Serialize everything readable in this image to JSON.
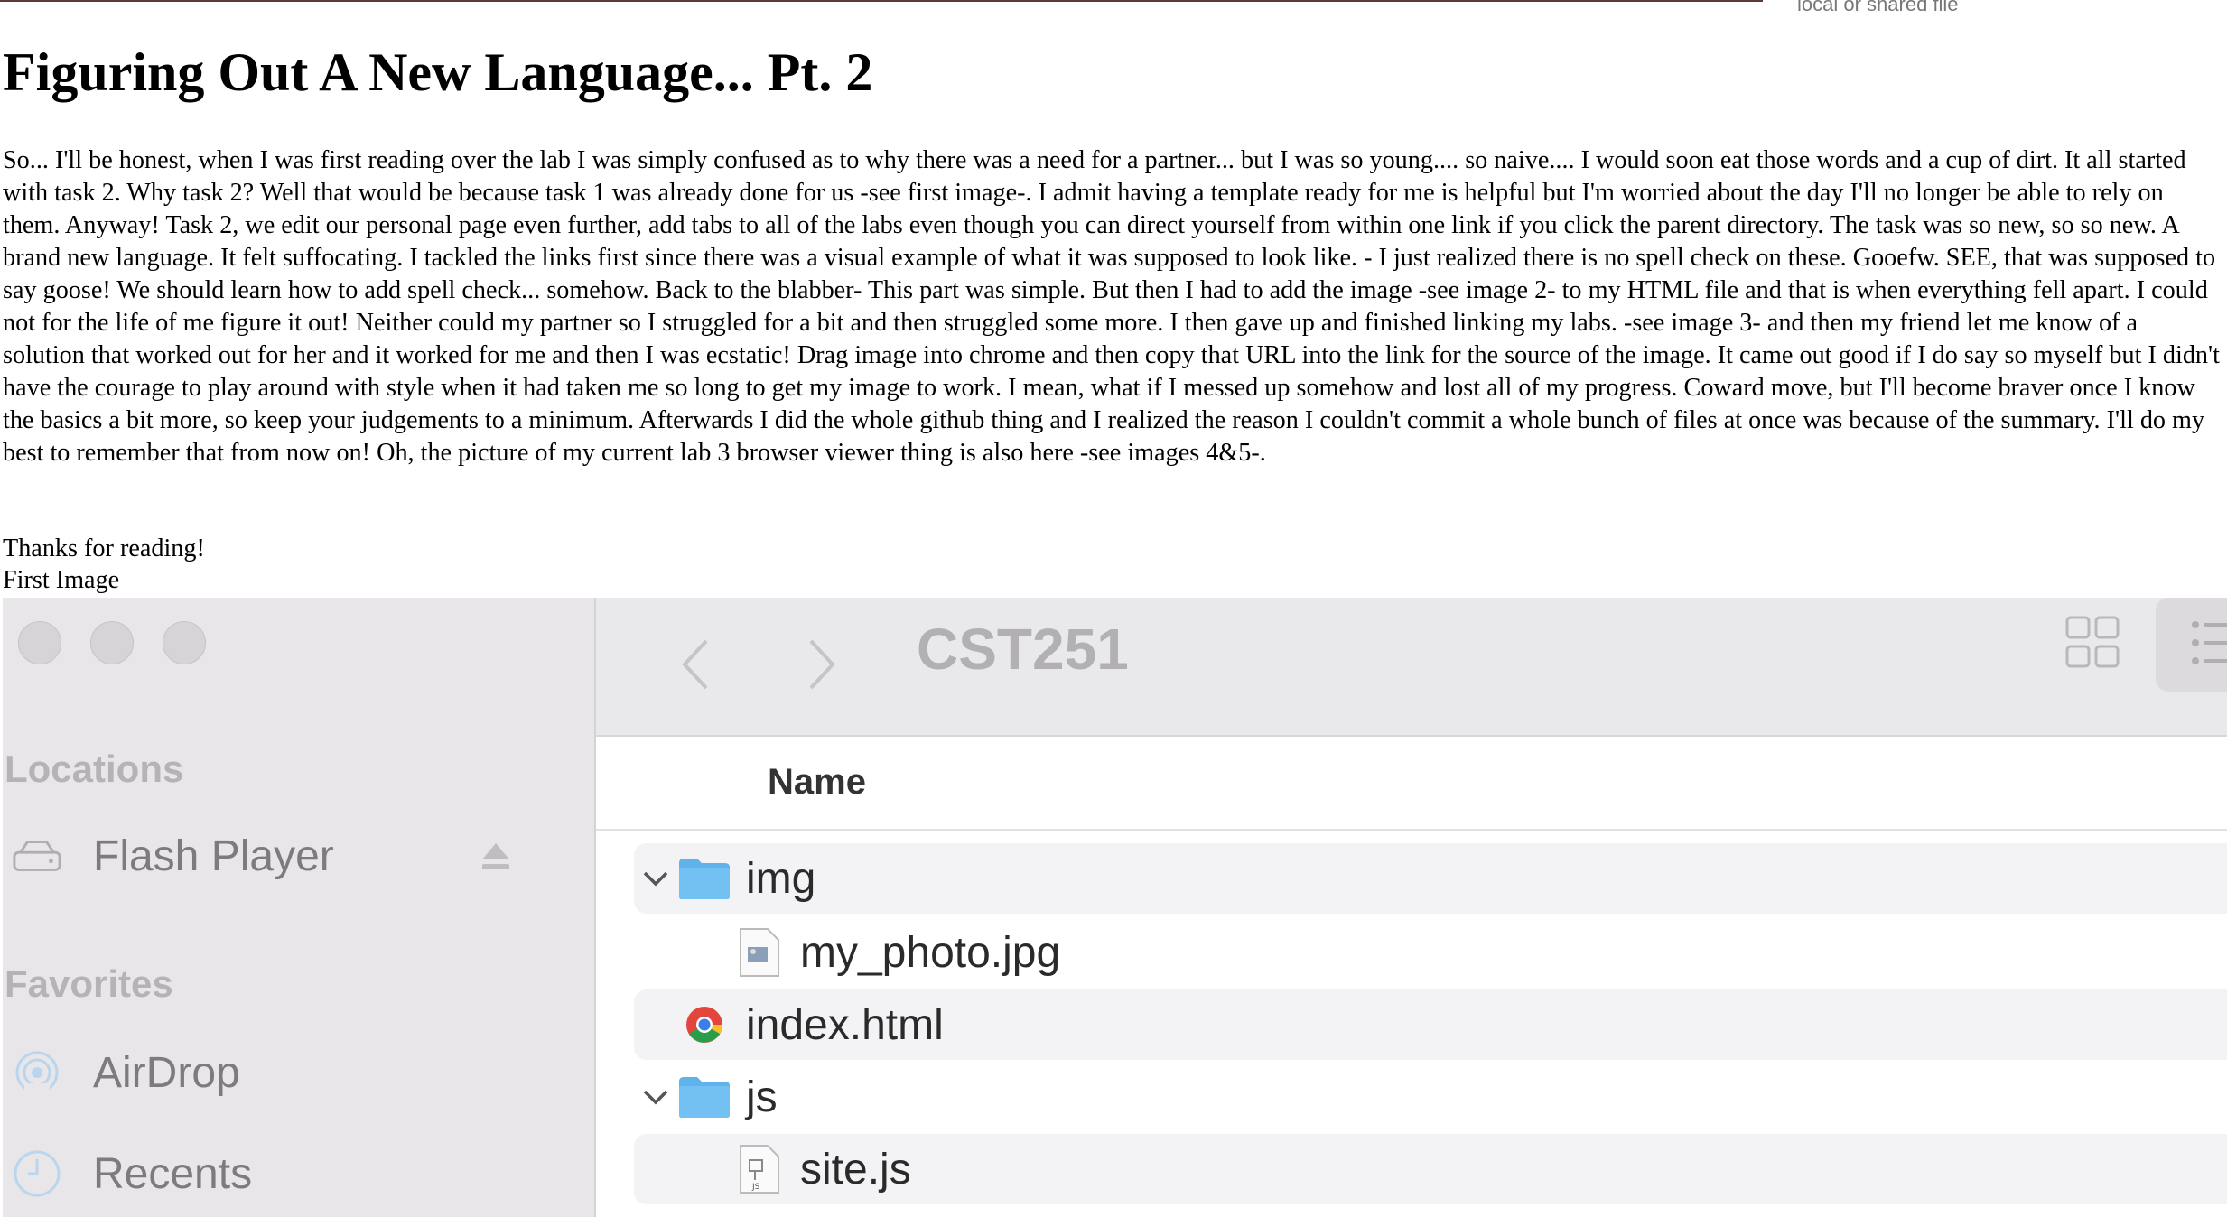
{
  "top_note": "local or shared file",
  "title": "Figuring Out A New Language... Pt. 2",
  "body": "So... I'll be honest, when I was first reading over the lab I was simply confused as to why there was a need for a partner... but I was so young.... so naive.... I would soon eat those words and a cup of dirt. It all started with task 2. Why task 2? Well that would be because task 1 was already done for us -see first image-. I admit having a template ready for me is helpful but I'm worried about the day I'll no longer be able to rely on them. Anyway! Task 2, we edit our personal page even further, add tabs to all of the labs even though you can direct yourself from within one link if you click the parent directory. The task was so new, so so new. A brand new language. It felt suffocating. I tackled the links first since there was a visual example of what it was supposed to look like. - I just realized there is no spell check on these. Gooefw. SEE, that was supposed to say goose! We should learn how to add spell check... somehow. Back to the blabber- This part was simple. But then I had to add the image -see image 2- to my HTML file and that is when everything fell apart. I could not for the life of me figure it out! Neither could my partner so I struggled for a bit and then struggled some more. I then gave up and finished linking my labs. -see image 3- and then my friend let me know of a solution that worked out for her and it worked for me and then I was ecstatic! Drag image into chrome and then copy that URL into the link for the source of the image. It came out good if I do say so myself but I didn't have the courage to play around with style when it had taken me so long to get my image to work. I mean, what if I messed up somehow and lost all of my progress. Coward move, but I'll become braver once I know the basics a bit more, so keep your judgements to a minimum. Afterwards I did the whole github thing and I realized the reason I couldn't commit a whole bunch of files at once was because of the summary. I'll do my best to remember that from now on! Oh, the picture of my current lab 3 browser viewer thing is also here -see images 4&5-.",
  "thanks": "Thanks for reading!",
  "caption": "First Image",
  "finder": {
    "folder_title": "CST251",
    "column_name": "Name",
    "sections": {
      "locations": "Locations",
      "favorites": "Favorites"
    },
    "sidebar": {
      "flash_player": "Flash Player",
      "airdrop": "AirDrop",
      "recents": "Recents"
    },
    "files": [
      {
        "label": "img",
        "icon": "folder-icon",
        "expanded": true
      },
      {
        "label": "my_photo.jpg",
        "icon": "image-file-icon"
      },
      {
        "label": "index.html",
        "icon": "chrome-file-icon"
      },
      {
        "label": "js",
        "icon": "folder-icon",
        "expanded": true
      },
      {
        "label": "site.js",
        "icon": "js-file-icon"
      }
    ],
    "colors": {
      "folder": "#5fb3ea",
      "sidebar": "#e8e6e8",
      "toolbar": "#e9e8ea"
    }
  }
}
